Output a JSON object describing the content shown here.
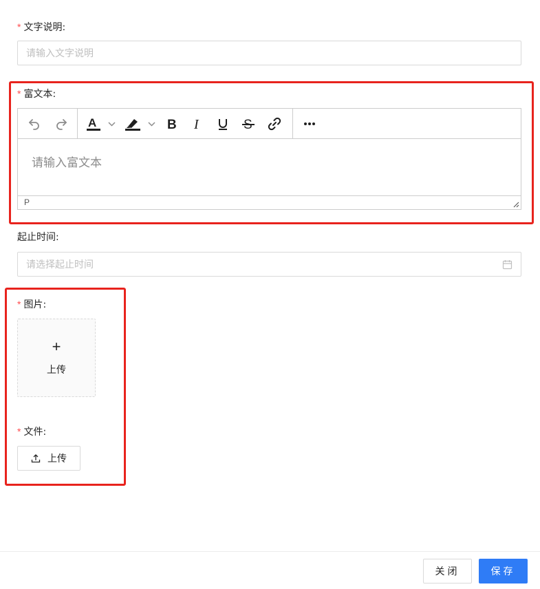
{
  "form": {
    "text_desc": {
      "required_mark": "*",
      "label": "文字说明:",
      "placeholder": "请输入文字说明"
    },
    "rich_text": {
      "required_mark": "*",
      "label": "富文本:",
      "placeholder": "请输入富文本",
      "status_path": "P",
      "toolbar": [
        "undo",
        "redo",
        "font-color",
        "background-color",
        "bold",
        "italic",
        "underline",
        "strikethrough",
        "link",
        "more"
      ]
    },
    "date_range": {
      "label": "起止时间:",
      "placeholder": "请选择起止时间"
    },
    "image": {
      "required_mark": "*",
      "label": "图片:",
      "plus": "+",
      "upload_text": "上传"
    },
    "file": {
      "required_mark": "*",
      "label": "文件:",
      "upload_text": "上传"
    }
  },
  "footer": {
    "close_label": "关闭",
    "save_label": "保存"
  },
  "colors": {
    "primary": "#2f7cf6",
    "required": "#ff4d4f",
    "highlight": "#e8231d"
  }
}
